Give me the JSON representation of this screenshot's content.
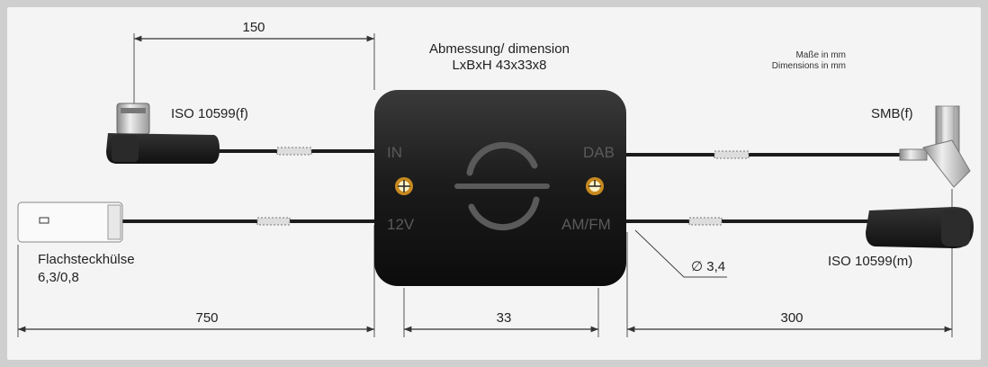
{
  "title": {
    "line1": "Abmessung/ dimension",
    "line2": "LxBxH 43x33x8"
  },
  "units_note": {
    "line1": "Maße in mm",
    "line2": "Dimensions in mm"
  },
  "dimensions": {
    "top_left": "150",
    "bottom_left": "750",
    "bottom_center": "33",
    "bottom_right": "300",
    "cable_diameter": "∅ 3,4"
  },
  "connectors": {
    "iso_female": "ISO 10599(f)",
    "smb_female": "SMB(f)",
    "iso_male": "ISO 10599(m)",
    "flat_plug_line1": "Flachsteckhülse",
    "flat_plug_line2": "6,3/0,8"
  },
  "ports": {
    "in": "IN",
    "dab": "DAB",
    "twelve_v": "12V",
    "amfm": "AM/FM"
  }
}
